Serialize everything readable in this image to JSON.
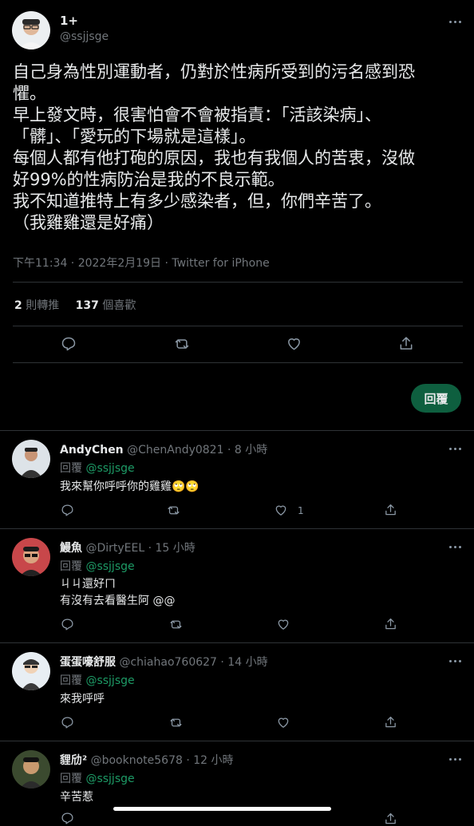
{
  "tweet": {
    "author_name": "1+",
    "author_handle": "@ssjjsge",
    "text": "自己身為性別運動者，仍對於性病所受到的污名感到恐\n懼。\n早上發文時，很害怕會不會被指責：「活該染病」、\n「髒」、「愛玩的下場就是這樣」。\n每個人都有他打砲的原因，我也有我個人的苦衷，沒做\n好99%的性病防治是我的不良示範。\n我不知道推特上有多少感染者，但，你們辛苦了。\n（我雞雞還是好痛）",
    "timestamp": "下午11:34 · 2022年2月19日 · Twitter for iPhone",
    "retweets_count": "2",
    "retweets_label": "則轉推",
    "likes_count": "137",
    "likes_label": "個喜歡"
  },
  "reply_button_label": "回覆",
  "replies": [
    {
      "name": "AndyChen",
      "handle": "@ChenAndy0821",
      "time": "· 8 小時",
      "reply_prefix": "回覆",
      "reply_to": "@ssjjsge",
      "text": "我來幫你呼呼你的雞雞",
      "emoji": "🙄🙄",
      "like_count": "1"
    },
    {
      "name": "鰻魚",
      "handle": "@DirtyEEL",
      "time": "· 15 小時",
      "reply_prefix": "回覆",
      "reply_to": "@ssjjsge",
      "text_line1": "ㄐㄐ還好ㄇ",
      "text_line2": "有沒有去看醫生阿 @@"
    },
    {
      "name": "蛋蛋嚎舒服",
      "handle": "@chiahao760627",
      "time": "· 14 小時",
      "reply_prefix": "回覆",
      "reply_to": "@ssjjsge",
      "text": "來我呼呼"
    },
    {
      "name": "貍劤²",
      "handle": "@booknote5678",
      "time": "· 12 小時",
      "reply_prefix": "回覆",
      "reply_to": "@ssjjsge",
      "text": "辛苦惹"
    }
  ],
  "icons": {
    "reply": "reply-icon",
    "retweet": "retweet-icon",
    "like": "heart-icon",
    "share": "share-icon",
    "more": "more-icon"
  },
  "colors": {
    "background": "#000000",
    "accent_green": "#1d9b66",
    "text": "#e7e9ea",
    "muted": "#71767b",
    "divider": "#2f3336"
  }
}
